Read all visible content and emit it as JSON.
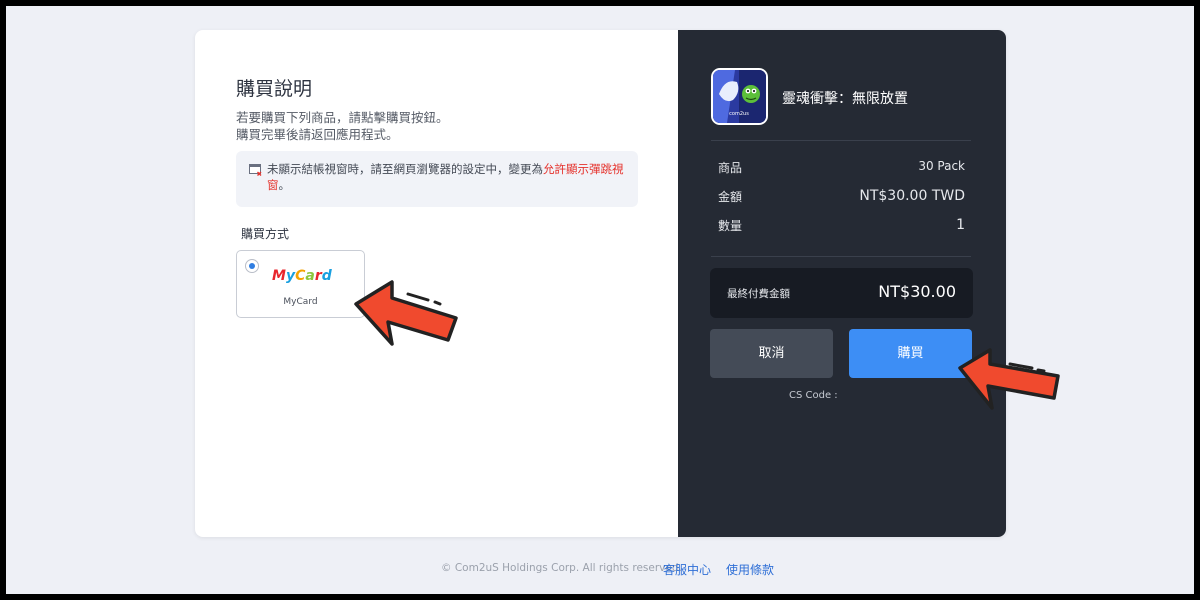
{
  "purchase_info": {
    "title": "購買說明",
    "instruction_line1": "若要購買下列商品，請點擊購買按鈕。",
    "instruction_line2": "購買完畢後請返回應用程式。",
    "notice_text_before": "未顯示結帳視窗時，請至網頁瀏覽器的設定中，變更為",
    "notice_text_highlight": "允許顯示彈跳視窗",
    "notice_text_after": "。",
    "notice_icon": "popup-blocked-icon"
  },
  "payment": {
    "method_label": "購買方式",
    "method": {
      "name": "MyCard",
      "logo_text": "MyCard",
      "selected": true
    }
  },
  "summary": {
    "game_name": "靈魂衝擊：無限放置",
    "game_icon_caption": "com2us",
    "rows": [
      {
        "label": "商品",
        "value": "30 Pack"
      },
      {
        "label": "金額",
        "value": "NT$30.00 TWD"
      },
      {
        "label": "數量",
        "value": "1"
      }
    ],
    "final_label": "最終付費金額",
    "final_amount": "NT$30.00",
    "cancel_label": "取消",
    "buy_label": "購買",
    "cs_code_label": "CS Code :"
  },
  "footer": {
    "copyright": "© Com2uS Holdings Corp. All rights reserved.",
    "support_link": "客服中心",
    "terms_link": "使用條款"
  },
  "colors": {
    "accent_blue": "#3d8ef5",
    "dark_panel": "#252a34",
    "highlight_red": "#e5312b",
    "annotation_arrow": "#f04a2e"
  }
}
